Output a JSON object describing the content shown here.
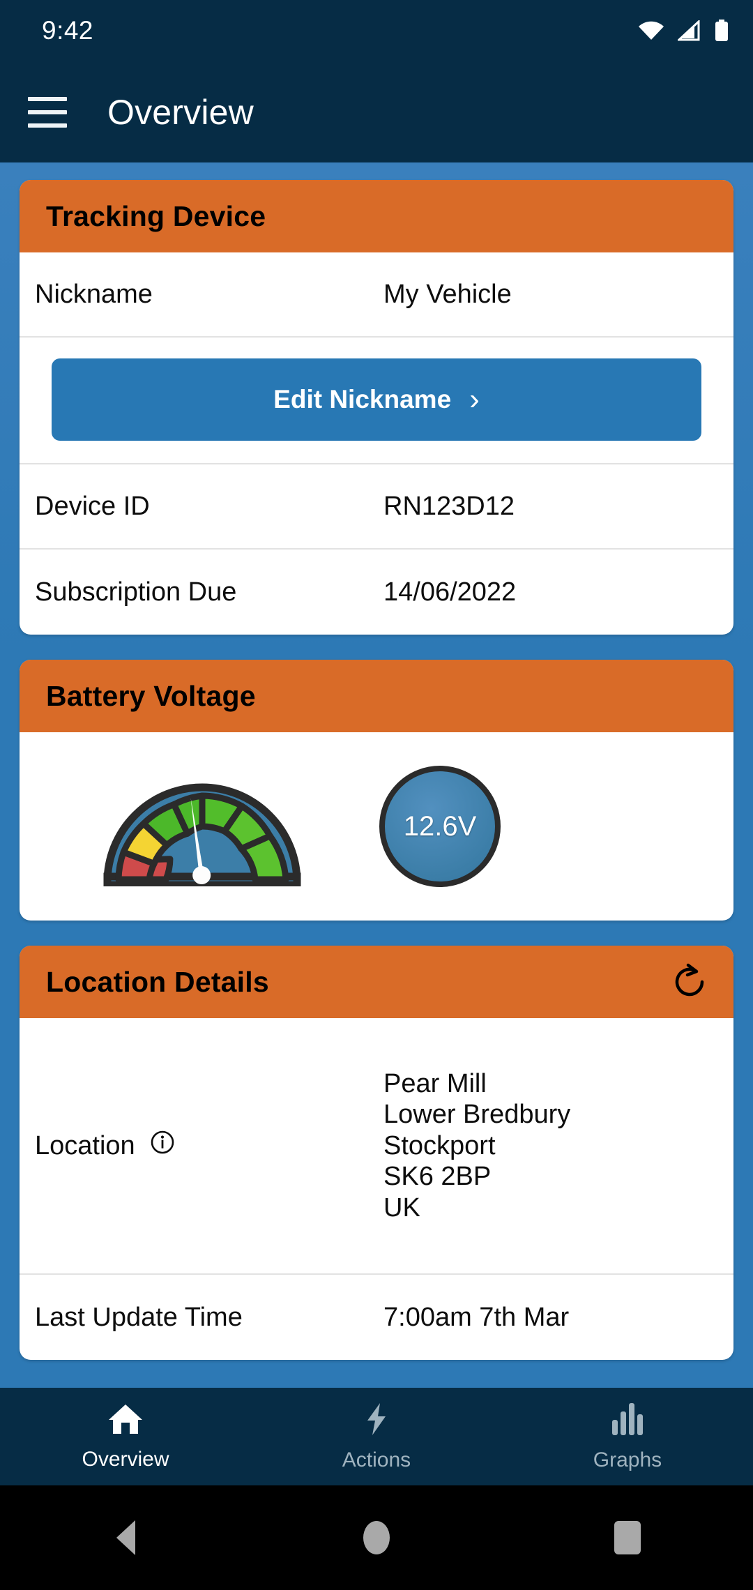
{
  "status_bar": {
    "time": "9:42",
    "icons": [
      "wifi-icon",
      "cellular-signal-icon",
      "battery-icon"
    ]
  },
  "app_bar": {
    "menu_icon": "hamburger-menu-icon",
    "title": "Overview"
  },
  "theme": {
    "header_navy": "#062c45",
    "page_blue": "#2d79b5",
    "card_header_orange": "#d96b28",
    "button_blue": "#2878b4",
    "card_white": "#ffffff",
    "gauge_red": "#cf4b4b",
    "gauge_yellow": "#f4d433",
    "gauge_green": "#4cb82a",
    "gauge_body_blue": "#3c7ea8",
    "nav_active": "#ffffff",
    "nav_inactive": "#9fb3bf"
  },
  "cards": {
    "tracking_device": {
      "title": "Tracking Device",
      "rows": [
        {
          "label": "Nickname",
          "value": "My Vehicle"
        },
        {
          "label": "Device ID",
          "value": "RN123D12"
        },
        {
          "label": "Subscription Due",
          "value": "14/06/2022"
        }
      ],
      "edit_button": {
        "label": "Edit Nickname",
        "chevron": "›"
      }
    },
    "battery_voltage": {
      "title": "Battery Voltage",
      "voltage": "12.6V",
      "gauge": {
        "icon": "gauge-dial-icon",
        "segments": [
          "red",
          "yellow",
          "green",
          "green",
          "green",
          "green"
        ],
        "needle_segment_index": 2,
        "needle_angle_deg": -8
      }
    },
    "location_details": {
      "title": "Location Details",
      "refresh_icon": "refresh-icon",
      "rows": [
        {
          "label": "Location",
          "info_icon": "info-icon",
          "address": [
            "Pear Mill",
            "Lower Bredbury",
            "Stockport",
            "SK6 2BP",
            "UK"
          ]
        },
        {
          "label": "Last Update Time",
          "value": "7:00am 7th Mar"
        }
      ]
    }
  },
  "bottom_nav": {
    "items": [
      {
        "label": "Overview",
        "icon": "home-icon",
        "active": true
      },
      {
        "label": "Actions",
        "icon": "lightning-bolt-icon",
        "active": false
      },
      {
        "label": "Graphs",
        "icon": "bar-chart-icon",
        "active": false
      }
    ]
  },
  "system_nav": {
    "back": "back-triangle-icon",
    "home": "home-circle-icon",
    "recents": "recents-square-icon"
  }
}
